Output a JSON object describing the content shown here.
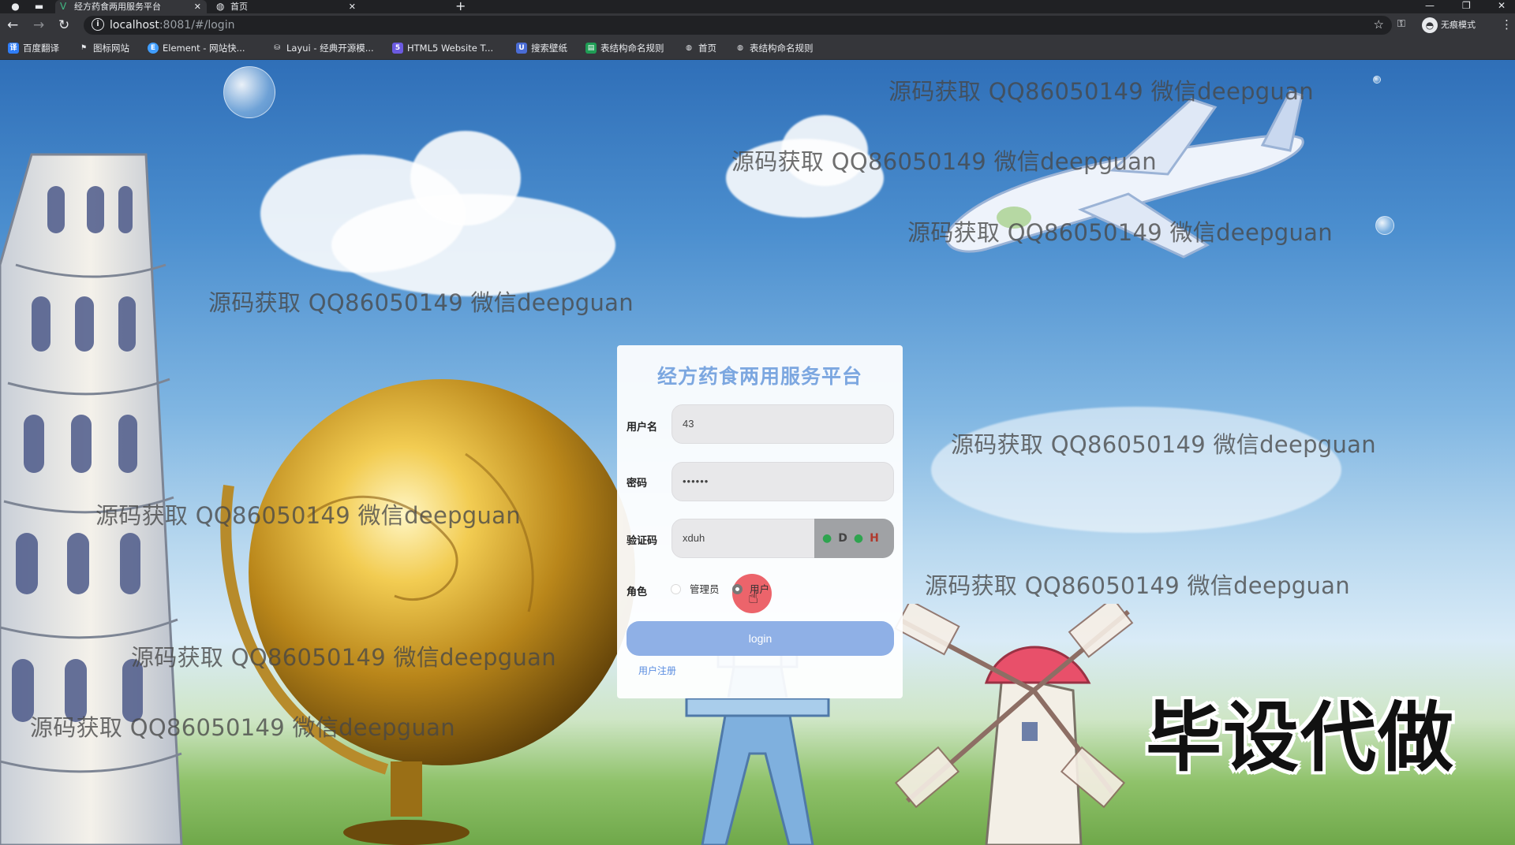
{
  "browser": {
    "tabs": [
      {
        "title": "经方药食两用服务平台",
        "active": true
      },
      {
        "title": "首页",
        "active": false
      }
    ],
    "url_host": "localhost",
    "url_rest": ":8081/#/login",
    "incognito_label": "无痕模式"
  },
  "bookmarks": [
    {
      "label": "百度翻译",
      "icon": "baidu-translate-icon",
      "color": "#2f7df6"
    },
    {
      "label": "图标网站",
      "icon": "flag-icon",
      "color": "#35363a"
    },
    {
      "label": "Element - 网站快...",
      "icon": "element-icon",
      "color": "#409eff"
    },
    {
      "label": "Layui - 经典开源模...",
      "icon": "layui-icon",
      "color": "#35363a"
    },
    {
      "label": "HTML5 Website T...",
      "icon": "html5-icon",
      "color": "#6b5ae0"
    },
    {
      "label": "搜索壁纸",
      "icon": "wallpaper-icon",
      "color": "#4a6cd4"
    },
    {
      "label": "表结构命名规则",
      "icon": "sheet-icon",
      "color": "#1f9d55"
    },
    {
      "label": "首页",
      "icon": "globe-icon",
      "color": "#35363a"
    },
    {
      "label": "表结构命名规则",
      "icon": "globe-icon",
      "color": "#35363a"
    }
  ],
  "login": {
    "title": "经方药食两用服务平台",
    "username_label": "用户名",
    "username_value": "43",
    "password_label": "密码",
    "password_value": "••••••",
    "captcha_label": "验证码",
    "captcha_value": "xduh",
    "captcha_chars": [
      {
        "char": "●",
        "color": "#2ea44f"
      },
      {
        "char": "D",
        "color": "#444444"
      },
      {
        "char": "●",
        "color": "#2ea44f"
      },
      {
        "char": "H",
        "color": "#b03a2e"
      }
    ],
    "role_label": "角色",
    "roles": [
      {
        "label": "管理员",
        "checked": false
      },
      {
        "label": "用户",
        "checked": true
      }
    ],
    "login_button": "login",
    "register_link": "用户注册"
  },
  "watermark_text": "源码获取 QQ86050149 微信deepguan",
  "promo_text": "毕设代做",
  "colors": {
    "title": "#7ca7e0",
    "button": "#8fb0e6",
    "link": "#5a8de0",
    "chrome_dark": "#202124",
    "chrome_toolbar": "#35363a"
  }
}
